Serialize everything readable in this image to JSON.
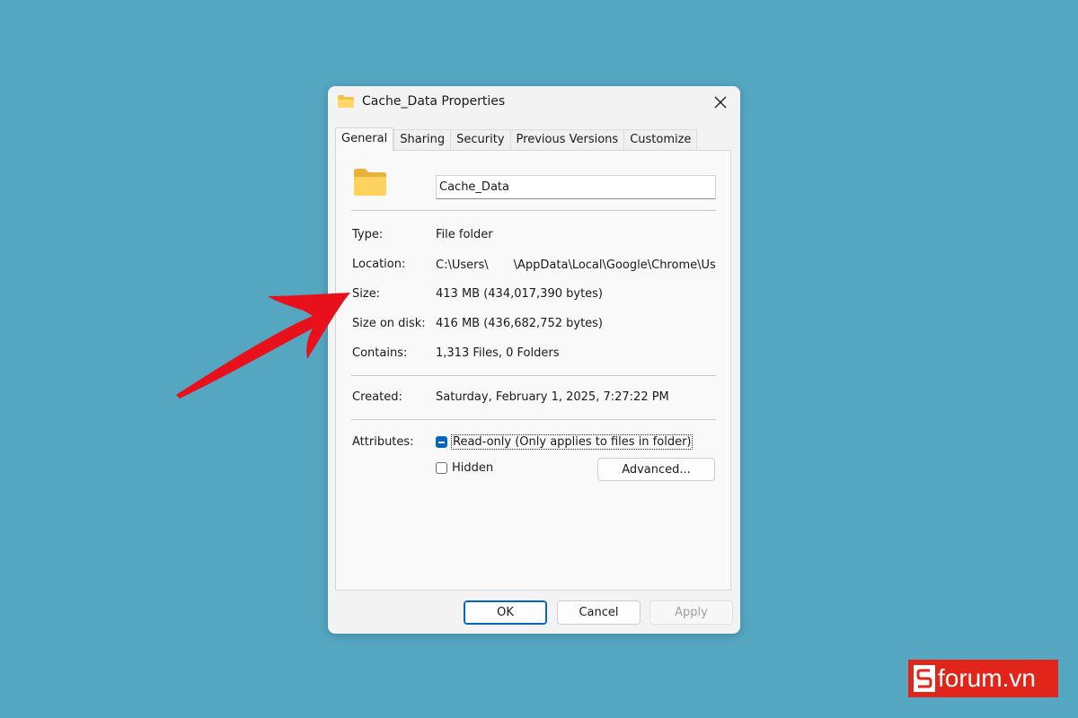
{
  "window": {
    "title": "Cache_Data Properties"
  },
  "tabs": [
    {
      "label": "General",
      "active": true
    },
    {
      "label": "Sharing",
      "active": false
    },
    {
      "label": "Security",
      "active": false
    },
    {
      "label": "Previous Versions",
      "active": false
    },
    {
      "label": "Customize",
      "active": false
    }
  ],
  "general": {
    "name_value": "Cache_Data",
    "type_label": "Type:",
    "type_value": "File folder",
    "location_label": "Location:",
    "location_value_start": "C:\\Users\\",
    "location_value_end": "\\AppData\\Local\\Google\\Chrome\\Us",
    "size_label": "Size:",
    "size_value": "413 MB (434,017,390 bytes)",
    "size_on_disk_label": "Size on disk:",
    "size_on_disk_value": "416 MB (436,682,752 bytes)",
    "contains_label": "Contains:",
    "contains_value": "1,313 Files, 0 Folders",
    "created_label": "Created:",
    "created_value": "Saturday, February 1, 2025, 7:27:22 PM",
    "attributes_label": "Attributes:",
    "readonly_label": "Read-only (Only applies to files in folder)",
    "readonly_state": "indeterminate",
    "hidden_label": "Hidden",
    "hidden_state": "unchecked",
    "advanced_label": "Advanced..."
  },
  "footer": {
    "ok_label": "OK",
    "cancel_label": "Cancel",
    "apply_label": "Apply"
  },
  "watermark": {
    "text": "forum.vn"
  },
  "colors": {
    "background": "#54a6c1",
    "accent": "#0067c0",
    "arrow": "#e8101a",
    "watermark_bg": "#e1251b"
  },
  "icons": [
    "folder-icon",
    "close-icon",
    "annotation-arrow"
  ]
}
